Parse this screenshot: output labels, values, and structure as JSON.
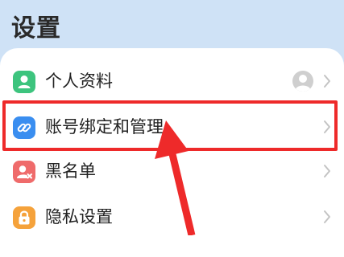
{
  "page": {
    "title": "设置"
  },
  "settings": {
    "items": [
      {
        "label": "个人资料",
        "icon": "person-icon",
        "icon_color": "#3dc47e"
      },
      {
        "label": "账号绑定和管理",
        "icon": "link-icon",
        "icon_color": "#3a8ef0"
      },
      {
        "label": "黑名单",
        "icon": "blocked-user-icon",
        "icon_color": "#ef6b6b"
      },
      {
        "label": "隐私设置",
        "icon": "lock-icon",
        "icon_color": "#f5a23b"
      }
    ]
  },
  "annotation": {
    "highlight_color": "#ee2a2a",
    "highlighted_item": "账号绑定和管理"
  }
}
